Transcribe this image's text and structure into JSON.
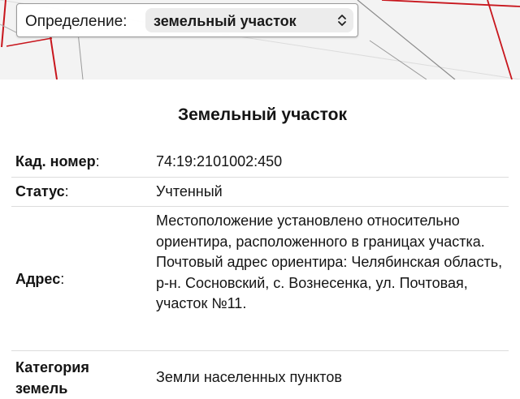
{
  "definition": {
    "label": "Определение:",
    "selected": "земельный участок",
    "icon": "chevron-updown-icon"
  },
  "panel": {
    "title": "Земельный участок",
    "rows": [
      {
        "label": "Кад. номер",
        "value": "74:19:2101002:450"
      },
      {
        "label": "Статус",
        "value": "Учтенный"
      },
      {
        "label": "Адрес",
        "value": "Местоположение установлено относительно ориентира, расположенного в границах участка. Почтовый адрес ориентира: Челябинская область, р-н. Сосновский, с. Вознесенка, ул. Почтовая, участок №11."
      },
      {
        "label": "Категория земель",
        "value": "Земли населенных пунктов"
      }
    ]
  },
  "colors": {
    "parcel_line": "#c8161d",
    "map_bg": "#f3f3f3",
    "row_divider": "#dcdcdc"
  }
}
